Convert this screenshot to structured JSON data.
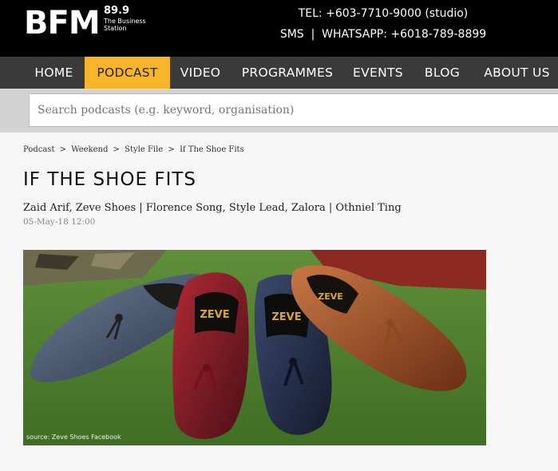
{
  "header": {
    "logo_text": "BFM",
    "logo_frequency": "89.9",
    "logo_tagline": "The Business Station",
    "tel": "TEL: +603-7710-9000 (studio)",
    "sms": "SMS  |  WHATSAPP: +6018-789-8899"
  },
  "nav": {
    "items": [
      "HOME",
      "PODCAST",
      "VIDEO",
      "PROGRAMMES",
      "EVENTS",
      "BLOG",
      "ABOUT US"
    ],
    "active": "PODCAST"
  },
  "search": {
    "placeholder": "Search podcasts (e.g. keyword, organisation)"
  },
  "breadcrumb": [
    "Podcast",
    ">",
    "Weekend",
    ">",
    "Style File",
    ">",
    "If The Shoe Fits"
  ],
  "article": {
    "title": "IF THE SHOE FITS",
    "guests": "Zaid Arif, Zeve Shoes | Florence Song, Style Lead, Zalora | Othniel Ting",
    "date": "05-May-18 12:00",
    "image_caption": "source: Zeve Shoes Facebook",
    "image_brand": "ZEVE"
  },
  "colors": {
    "nav_active": "#f7b52c",
    "nav_bg": "#3a3a3a",
    "topbar_bg": "#000000"
  }
}
